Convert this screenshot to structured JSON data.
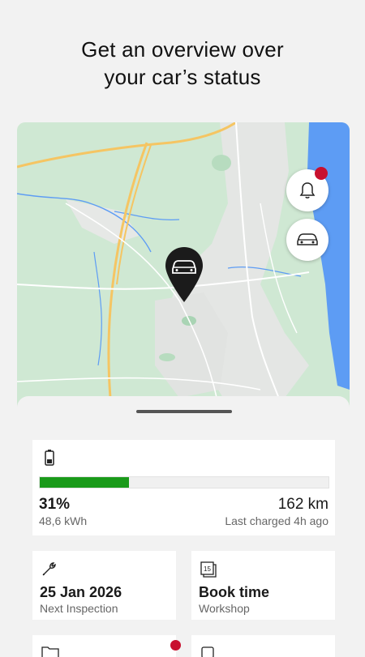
{
  "headline": {
    "line1": "Get an overview over",
    "line2": "your car’s status"
  },
  "map": {
    "buttons": [
      {
        "name": "notifications",
        "icon": "bell-icon",
        "has_badge": true
      },
      {
        "name": "vehicle",
        "icon": "car-icon"
      }
    ],
    "marker_icon": "car-icon"
  },
  "battery": {
    "icon": "battery-icon",
    "level_percent": 31,
    "percent_label": "31%",
    "energy": "48,6 kWh",
    "range": "162 km",
    "last_charged": "Last charged 4h ago",
    "bar_color": "#1a9a1a"
  },
  "inspection": {
    "icon": "wrench-icon",
    "date": "25 Jan 2026",
    "label": "Next Inspection"
  },
  "workshop": {
    "icon": "calendar-icon",
    "calendar_day": "15",
    "title": "Book time",
    "label": "Workshop"
  },
  "colors": {
    "accent_red": "#c8102e",
    "map_land": "#cfe8d3",
    "map_water": "#5d9cf4",
    "map_highway": "#f5c563"
  }
}
